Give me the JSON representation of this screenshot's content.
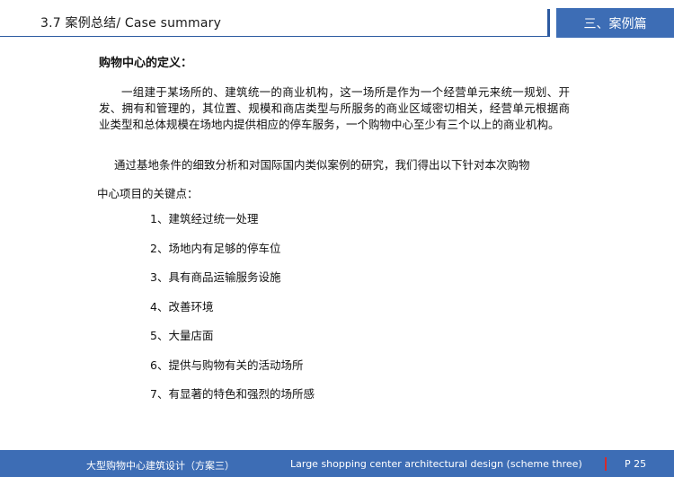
{
  "header": {
    "title": "3.7   案例总结/ Case summary",
    "section_tab": "三、案例篇",
    "accent_color": "#3d6db5"
  },
  "content": {
    "definition_heading": "购物中心的定义：",
    "definition_text": "一组建于某场所的、建筑统一的商业机构，这一场所是作为一个经营单元来统一规划、开发、拥有和管理的，其位置、规模和商店类型与所服务的商业区域密切相关，经营单元根据商业类型和总体规模在场地内提供相应的停车服务，一个购物中心至少有三个以上的商业机构。",
    "analysis_line1": "通过基地条件的细致分析和对国际国内类似案例的研究，我们得出以下针对本次购物",
    "analysis_line2": "中心项目的关键点：",
    "key_points": [
      "1、建筑经过统一处理",
      "2、场地内有足够的停车位",
      "3、具有商品运输服务设施",
      "4、改善环境",
      "5、大量店面",
      "6、提供与购物有关的活动场所",
      "7、有显著的特色和强烈的场所感"
    ]
  },
  "footer": {
    "title_cn": "大型购物中心建筑设计（方案三）",
    "title_en": "Large shopping center architectural design (scheme three)",
    "page": "P  25",
    "separator_color": "#d62b2b"
  }
}
